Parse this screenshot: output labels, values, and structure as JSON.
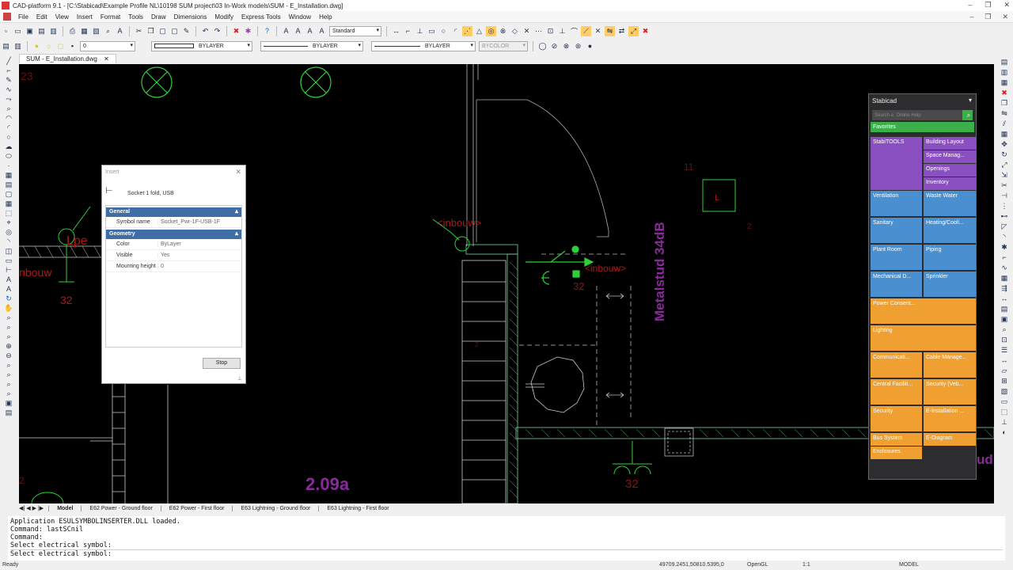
{
  "window": {
    "title": "CAD-platform 9.1 - [C:\\Stabicad\\Example Profile NL\\10198 SUM project\\03 In-Work models\\SUM - E_Installation.dwg]",
    "controls": [
      "–",
      "❐",
      "✕"
    ]
  },
  "menu": [
    "File",
    "Edit",
    "View",
    "Insert",
    "Format",
    "Tools",
    "Draw",
    "Dimensions",
    "Modify",
    "Express Tools",
    "Window",
    "Help"
  ],
  "toolbar": {
    "text_style": "Standard",
    "layer_value": "0",
    "color": "BYLAYER",
    "linetype": "BYLAYER",
    "lineweight": "BYLAYER",
    "plotstyle": "BYCOLOR"
  },
  "document_tab": {
    "label": "SUM - E_Installation.dwg",
    "close": "✕"
  },
  "insert_dialog": {
    "title": "Insert",
    "close": "✕",
    "symbol_name_display": "Socket 1 fold, USB",
    "groups": [
      {
        "label": "General",
        "rows": [
          {
            "key": "Symbol name",
            "value": "Socket_Pwr-1F-USB-1F"
          }
        ]
      },
      {
        "label": "Geometry",
        "rows": [
          {
            "key": "Color",
            "value": "ByLayer"
          },
          {
            "key": "Visible",
            "value": "Yes"
          },
          {
            "key": "Mounting height",
            "value": "0"
          }
        ]
      }
    ],
    "stop_label": "Stop"
  },
  "stabicad_panel": {
    "title": "Stabicad",
    "search_placeholder": "Search e. Online Help",
    "favorites": "Favorites",
    "tiles": [
      {
        "label": "StabiTOOLS",
        "color": "#8a4fc0"
      },
      {
        "label": "Building Layout",
        "color": "#8a4fc0"
      },
      {
        "label": "Space Manag...",
        "color": "#8a4fc0"
      },
      {
        "label": "Openings",
        "color": "#8a4fc0"
      },
      {
        "label": "Inventory",
        "color": "#8a4fc0"
      },
      {
        "label": "Ventilation",
        "color": "#4a90d0"
      },
      {
        "label": "Waste Water",
        "color": "#4a90d0"
      },
      {
        "label": "Sanitary",
        "color": "#4a90d0"
      },
      {
        "label": "Heating/Cooli...",
        "color": "#4a90d0"
      },
      {
        "label": "Plant Room",
        "color": "#4a90d0"
      },
      {
        "label": "Piping",
        "color": "#4a90d0"
      },
      {
        "label": "Mechanical D...",
        "color": "#4a90d0"
      },
      {
        "label": "Sprinkler",
        "color": "#4a90d0"
      },
      {
        "label": "Power Consent...",
        "color": "#f0a030"
      },
      {
        "label": "Lighting",
        "color": "#f0a030"
      },
      {
        "label": "Communicati...",
        "color": "#f0a030"
      },
      {
        "label": "Cable Manage...",
        "color": "#f0a030"
      },
      {
        "label": "Central Faciliti...",
        "color": "#f0a030"
      },
      {
        "label": "Security (Veb...",
        "color": "#f0a030"
      },
      {
        "label": "Security",
        "color": "#f0a030"
      },
      {
        "label": "E-Installation ...",
        "color": "#f0a030"
      },
      {
        "label": "Bus System",
        "color": "#f0a030"
      },
      {
        "label": "E-Diagram",
        "color": "#f0a030"
      },
      {
        "label": "Enclosures",
        "color": "#f0a030"
      }
    ]
  },
  "drawing": {
    "labels": {
      "metalstud": "Metalstud 34dB",
      "room": "2.09a",
      "inbouw_a": "<inbouw>",
      "inbouw_b": "inbouw",
      "inbouw_c": "<inbouw>",
      "n11": "11",
      "n23": "23",
      "n32a": "32",
      "n32b": "32",
      "n32c": "32",
      "n2": "2",
      "nL": "L",
      "ud": "ud",
      "lpe": "Lpe"
    }
  },
  "layout_tabs": [
    "Model",
    "E62 Power - Ground floor",
    "E62 Power - First floor",
    "E63 Lightning - Ground floor",
    "E63 Lightning - First floor"
  ],
  "command_lines": [
    "Application ESULSYMBOLINSERTER.DLL loaded.",
    "Command: lastSCnil",
    "Command:",
    "Select electrical symbol:",
    "Select electrical symbol:"
  ],
  "status": {
    "ready": "Ready",
    "coords": "49709.2451,50810.5395,0",
    "opengl": "OpenGL",
    "scale": "1:1",
    "model": "MODEL"
  }
}
